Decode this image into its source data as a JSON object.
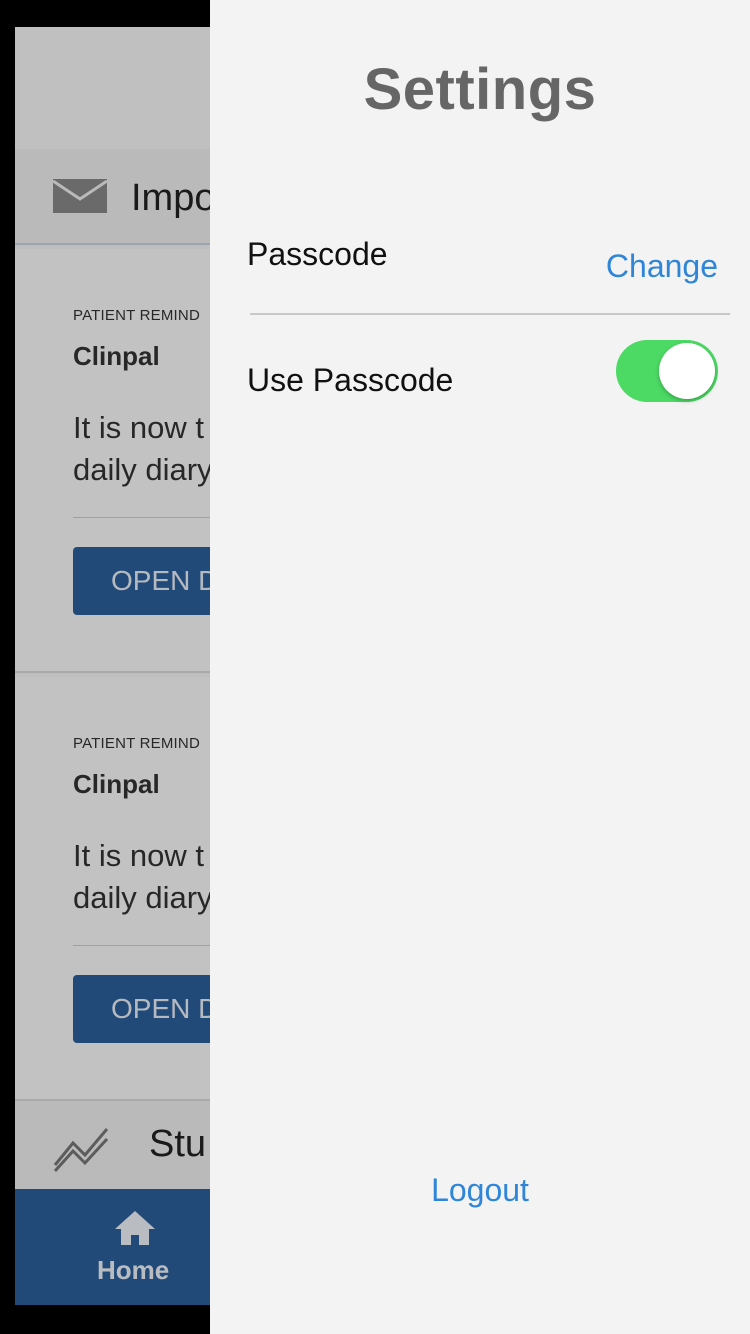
{
  "background_app": {
    "section_important_title": "Impo",
    "cards": [
      {
        "kicker": "PATIENT REMIND",
        "sender": "Clinpal",
        "body_line1": "It is now t",
        "body_line2": "daily diary",
        "button_label": "OPEN D"
      },
      {
        "kicker": "PATIENT REMIND",
        "sender": "Clinpal",
        "body_line1": "It is now t",
        "body_line2": "daily diary",
        "button_label": "OPEN D"
      }
    ],
    "section_study_title": "Stu",
    "tabbar": {
      "home_label": "Home"
    }
  },
  "drawer": {
    "title": "Settings",
    "passcode_label": "Passcode",
    "change_label": "Change",
    "use_passcode_label": "Use Passcode",
    "use_passcode_enabled": true,
    "logout_label": "Logout"
  },
  "colors": {
    "accent": "#2f86d8",
    "toggle_on": "#4cd964",
    "tab_blue": "#2c5f9a"
  }
}
